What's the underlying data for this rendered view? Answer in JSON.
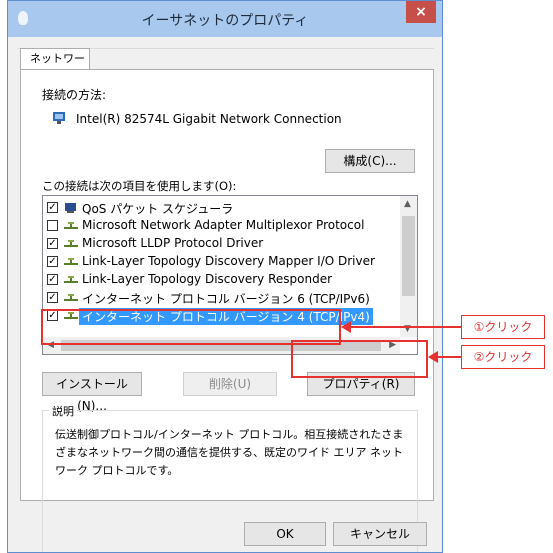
{
  "window": {
    "title": "イーサネットのプロパティ",
    "close_glyph": "×"
  },
  "tab": {
    "label": "ネットワーク"
  },
  "connect_using": {
    "label": "接続の方法:",
    "adapter": "Intel(R) 82574L Gigabit Network Connection",
    "configure_button": "構成(C)..."
  },
  "items": {
    "label": "この接続は次の項目を使用します(O):",
    "rows": [
      {
        "checked": true,
        "text": "QoS パケット スケジューラ",
        "icon": "qos-icon"
      },
      {
        "checked": false,
        "text": "Microsoft Network Adapter Multiplexor Protocol",
        "icon": "protocol-icon"
      },
      {
        "checked": true,
        "text": "Microsoft LLDP Protocol Driver",
        "icon": "protocol-icon"
      },
      {
        "checked": true,
        "text": "Link-Layer Topology Discovery Mapper I/O Driver",
        "icon": "protocol-icon"
      },
      {
        "checked": true,
        "text": "Link-Layer Topology Discovery Responder",
        "icon": "protocol-icon"
      },
      {
        "checked": true,
        "text": "インターネット プロトコル バージョン 6 (TCP/IPv6)",
        "icon": "protocol-icon"
      },
      {
        "checked": true,
        "text": "インターネット プロトコル バージョン 4 (TCP/IPv4)",
        "icon": "protocol-icon",
        "selected": true
      }
    ]
  },
  "buttons": {
    "install": "インストール(N)...",
    "uninstall": "削除(U)",
    "properties": "プロパティ(R)"
  },
  "description": {
    "label": "説明",
    "text": "伝送制御プロトコル/インターネット プロトコル。相互接続されたさまざまなネットワーク間の通信を提供する、既定のワイド エリア ネットワーク プロトコルです。"
  },
  "footer": {
    "ok": "OK",
    "cancel": "キャンセル"
  },
  "annotations": {
    "step1": "①クリック",
    "step2": "②クリック"
  },
  "colors": {
    "accent": "#e5312f",
    "selection": "#3399ff",
    "titlebar": "#a9c8ee"
  }
}
